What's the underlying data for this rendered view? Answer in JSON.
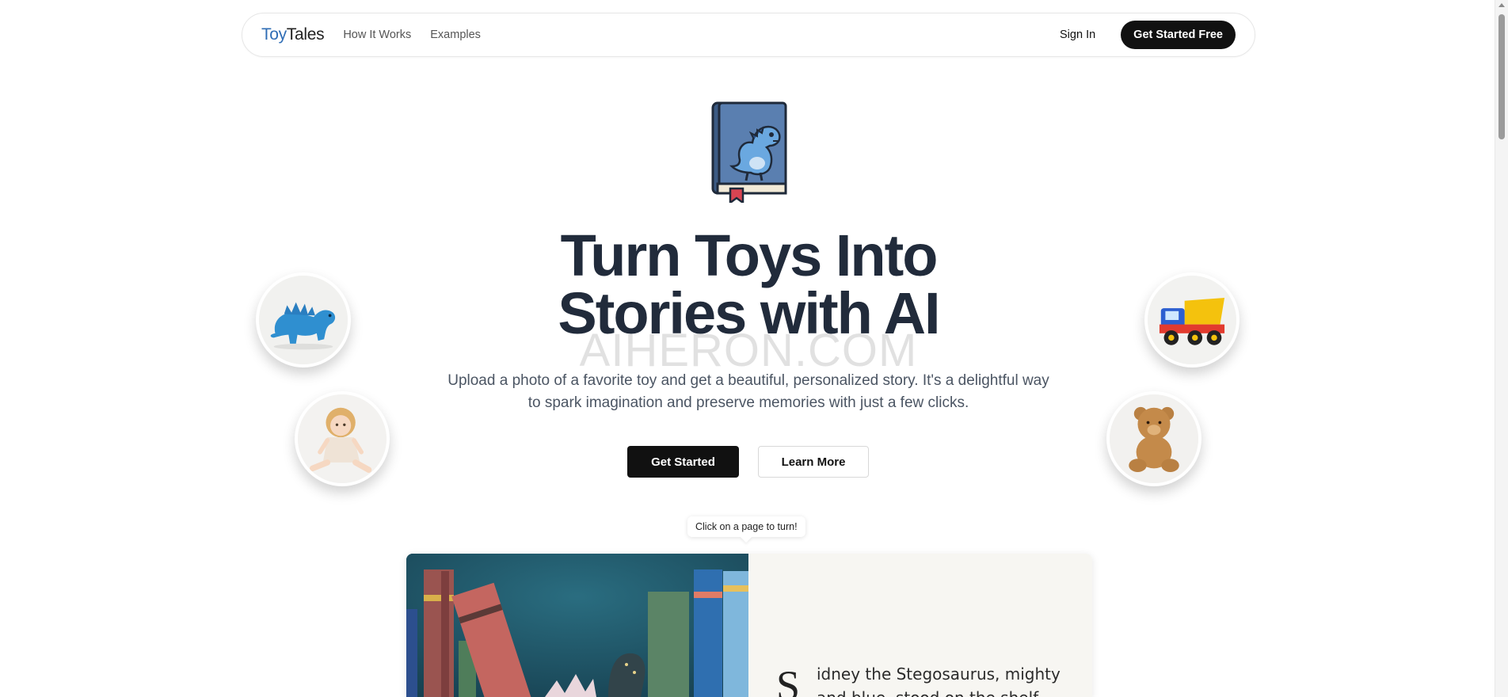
{
  "nav": {
    "logo_part1": "Toy",
    "logo_part2": "Tales",
    "links": [
      "How It Works",
      "Examples"
    ],
    "sign_in": "Sign In",
    "cta": "Get Started Free"
  },
  "hero": {
    "title_line1": "Turn Toys Into",
    "title_line2": "Stories with AI",
    "watermark": "AIHERON.COM",
    "subtitle_line1": "Upload a photo of a favorite toy and get a beautiful, personalized story. It's a delightful way",
    "subtitle_line2": "to spark imagination and preserve memories with just a few clicks.",
    "primary_button": "Get Started",
    "secondary_button": "Learn More"
  },
  "toys": [
    "blue-dinosaur-toy",
    "doll-toy",
    "dump-truck-toy",
    "teddy-bear-toy"
  ],
  "storybook": {
    "hint": "Click on a page to turn!",
    "dropcap": "S",
    "line1": "idney the Stegosaurus, mighty",
    "line2": "and blue, stood on the shelf..."
  },
  "colors": {
    "logo_accent": "#2f6db5",
    "primary": "#111111",
    "title": "#212b3b",
    "book_cover": "#4a6f9e",
    "bookmark": "#d94452"
  }
}
